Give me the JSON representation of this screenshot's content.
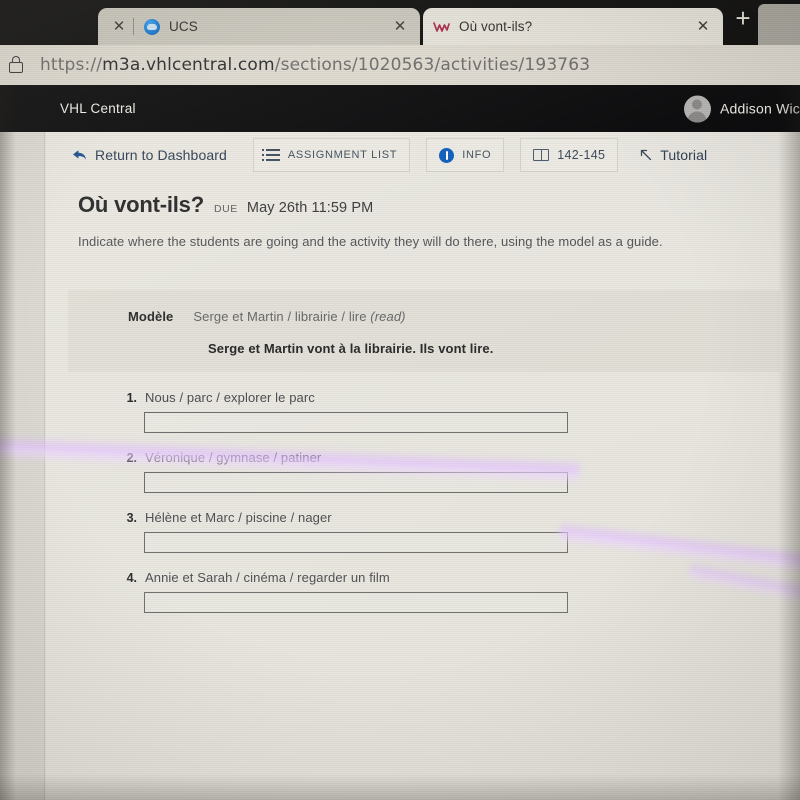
{
  "browser": {
    "tabs": [
      {
        "title": "UCS",
        "favicon": "cloud-icon",
        "active": false,
        "close_label": "✕",
        "lead_close_label": "✕"
      },
      {
        "title": "Où vont-ils?",
        "favicon": "vhl-logo-icon",
        "active": true,
        "close_label": "✕"
      }
    ],
    "new_tab_label": "+",
    "url": {
      "scheme": "https://",
      "host": "m3a.vhlcentral.com",
      "path": "/sections/1020563/activities/193763",
      "full": "https://m3a.vhlcentral.com/sections/1020563/activities/193763"
    }
  },
  "app_header": {
    "brand": "VHL Central",
    "account_name": "Addison Wic"
  },
  "toolbar": {
    "return_label": "Return to Dashboard",
    "assignment_list_label": "ASSIGNMENT LIST",
    "info_label": "INFO",
    "pages_label": "142-145",
    "tutorial_label": "Tutorial"
  },
  "activity": {
    "title": "Où vont-ils?",
    "due_label": "DUE",
    "due_value": "May 26th 11:59 PM",
    "instructions": "Indicate where the students are going and the activity they will do there, using the model as a guide."
  },
  "modele": {
    "label": "Modèle",
    "prompt_plain": "Serge et Martin / librairie / lire ",
    "prompt_italic": "(read)",
    "answer": "Serge et Martin vont à la librairie. Ils vont lire."
  },
  "questions": [
    {
      "number": "1.",
      "prompt": "Nous / parc / explorer le parc",
      "answer": ""
    },
    {
      "number": "2.",
      "prompt": "Véronique / gymnase / patiner",
      "answer": ""
    },
    {
      "number": "3.",
      "prompt": "Hélène et Marc / piscine / nager",
      "answer": ""
    },
    {
      "number": "4.",
      "prompt": "Annie et Sarah / cinéma / regarder un film",
      "answer": ""
    }
  ],
  "colors": {
    "app_header_bg": "#0a0a0c",
    "page_bg": "#e6e4dd",
    "link_blue": "#3e4c5c",
    "info_blue": "#0f5fbe",
    "vhl_logo_red": "#a8294a",
    "glare_purple": "#e0baff"
  }
}
